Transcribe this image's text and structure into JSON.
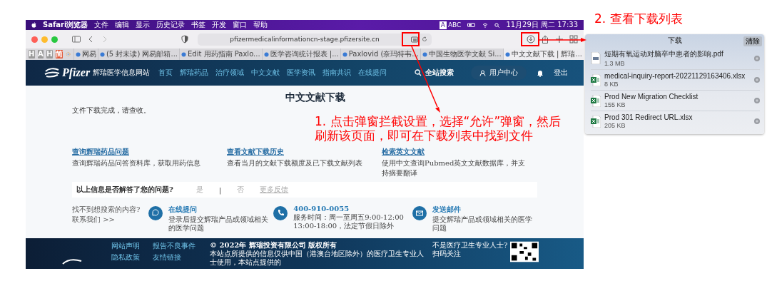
{
  "menubar": {
    "app": "Safari浏览器",
    "menus": [
      "文件",
      "编辑",
      "显示",
      "历史记录",
      "书签",
      "开发",
      "窗口",
      "帮助"
    ],
    "input_icon": "A",
    "input_label": "ABC",
    "clock": "11月29日 周二 17:33"
  },
  "browser": {
    "url": "pfizermedicalinformationcn-stage.pfizersite.cn"
  },
  "bookmarks": [
    "H",
    "A",
    "H",
    "简"
  ],
  "tabs": [
    {
      "title": "网易",
      "selected": false
    },
    {
      "title": "(5 封未读) 网易邮箱...",
      "selected": false
    },
    {
      "title": "Edit 用药指南 Paxlo...",
      "selected": false
    },
    {
      "title": "医学咨询统计报表 |...",
      "selected": false
    },
    {
      "title": "Paxlovid (奈玛特韦...",
      "selected": false
    },
    {
      "title": "中国生物医学文献 Si...",
      "selected": false
    },
    {
      "title": "中文文献下载 | 辉瑞...",
      "selected": true
    }
  ],
  "site": {
    "logo": "Pfizer",
    "site_name": "辉瑞医学信息网站",
    "nav": [
      "首页",
      "辉瑞药品",
      "治疗领域",
      "中文文献",
      "医学资讯",
      "指南共识",
      "在线提问"
    ],
    "search": "全站搜索",
    "user_center": "用户中心",
    "logout": "登出"
  },
  "page": {
    "title": "中文文献下载",
    "message": "文件下载完成，请查收。",
    "links": [
      {
        "title": "查询辉瑞药品问题",
        "desc": "查询辉瑞药品问答资料库，获取用药信息"
      },
      {
        "title": "查看文献下载历史",
        "desc": "查看当月的文献下载额度及已下载文献列表"
      },
      {
        "title": "检索英文文献",
        "desc": "使用中文查询Pubmed英文文献数据库，并支持摘要翻译"
      }
    ],
    "feedback": {
      "question": "以上信息是否解答了您的问题?",
      "yes": "是",
      "separator": "|",
      "no": "否",
      "more": "更多反馈"
    },
    "contact": {
      "prompt": "找不到想搜索的内容?",
      "link": "联系我们 >>",
      "items": [
        {
          "kind": "chat",
          "title": "在线提问",
          "desc": "登录后提交辉瑞产品或领域相关的医学问题"
        },
        {
          "kind": "phone",
          "title": "400-910-0055",
          "desc": "服务时间：周一至周五9:00-12:00 13:00-18:00，法定节假日除外"
        },
        {
          "kind": "mail",
          "title": "发送邮件",
          "desc": "提交辉瑞产品或领域相关的医学问题"
        }
      ]
    }
  },
  "footer": {
    "links": [
      "网站声明",
      "报告不良事件",
      "隐私政策",
      "友情链接"
    ],
    "copyright": "© 2022年 辉瑞投资有限公司 版权所有",
    "notice": "本站点所提供的信息仅供中国（港澳台地区除外）的医疗卫生专业人士使用，本站点提供的",
    "qr_prompt": "不是医疗卫生专业人士?",
    "qr_caption": "扫码关注"
  },
  "downloads": {
    "title": "下载",
    "clear": "清除",
    "items": [
      {
        "kind": "pdf",
        "name": "短期有氧运动对脑卒中患者的影响.pdf",
        "size": "1.3 MB"
      },
      {
        "kind": "xlsx",
        "name": "medical-inquiry-report-20221129163406.xlsx",
        "size": "8 KB"
      },
      {
        "kind": "xlsx",
        "name": "Prod  New Migration Checklist",
        "size": "155 KB"
      },
      {
        "kind": "xlsx",
        "name": "Prod 301 Redirect URL.xlsx",
        "size": "205 KB"
      }
    ]
  },
  "annotations": [
    "1. 点击弹窗拦截设置，选择“允许”弹窗，然后刷新该页面，即可在下载列表中找到文件",
    "2. 查看下载列表"
  ]
}
